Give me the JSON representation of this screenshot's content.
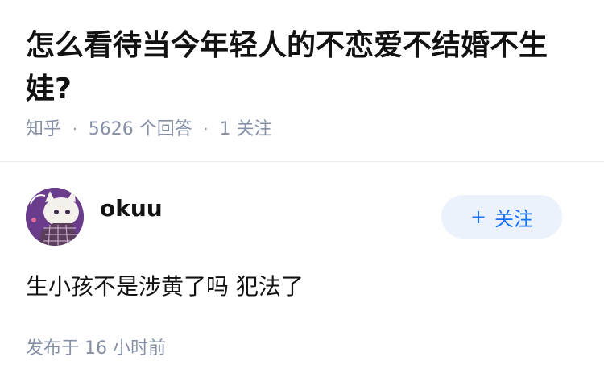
{
  "question": {
    "title": "怎么看待当今年轻人的不恋爱不结婚不生娃?",
    "source": "知乎",
    "answer_count": "5626 个回答",
    "follow_count": "1 关注",
    "separator": "·"
  },
  "answer": {
    "author": "okuu",
    "follow_label": "关注",
    "follow_symbol": "+",
    "content": "生小孩不是涉黄了吗 犯法了",
    "time": "发布于 16 小时前"
  },
  "colors": {
    "text_primary": "#121212",
    "text_secondary": "#8590a6",
    "accent": "#1772f6",
    "follow_bg": "#ebf2fb",
    "avatar_bg": "#6a3c8c"
  },
  "icons": {
    "avatar": "anime-cat-avatar"
  }
}
